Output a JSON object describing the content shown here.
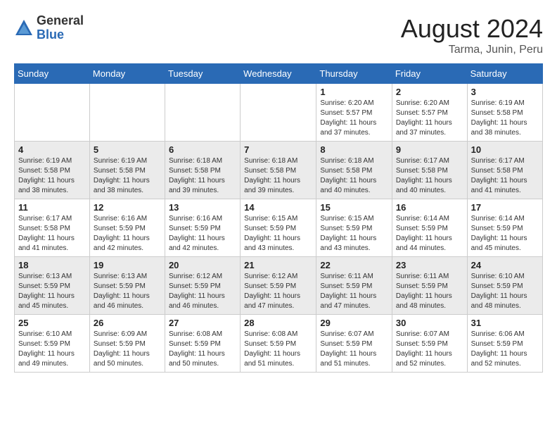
{
  "header": {
    "logo_general": "General",
    "logo_blue": "Blue",
    "month_year": "August 2024",
    "location": "Tarma, Junin, Peru"
  },
  "weekdays": [
    "Sunday",
    "Monday",
    "Tuesday",
    "Wednesday",
    "Thursday",
    "Friday",
    "Saturday"
  ],
  "weeks": [
    {
      "days": [
        {
          "num": "",
          "info": ""
        },
        {
          "num": "",
          "info": ""
        },
        {
          "num": "",
          "info": ""
        },
        {
          "num": "",
          "info": ""
        },
        {
          "num": "1",
          "info": "Sunrise: 6:20 AM\nSunset: 5:57 PM\nDaylight: 11 hours\nand 37 minutes."
        },
        {
          "num": "2",
          "info": "Sunrise: 6:20 AM\nSunset: 5:57 PM\nDaylight: 11 hours\nand 37 minutes."
        },
        {
          "num": "3",
          "info": "Sunrise: 6:19 AM\nSunset: 5:58 PM\nDaylight: 11 hours\nand 38 minutes."
        }
      ]
    },
    {
      "days": [
        {
          "num": "4",
          "info": "Sunrise: 6:19 AM\nSunset: 5:58 PM\nDaylight: 11 hours\nand 38 minutes."
        },
        {
          "num": "5",
          "info": "Sunrise: 6:19 AM\nSunset: 5:58 PM\nDaylight: 11 hours\nand 38 minutes."
        },
        {
          "num": "6",
          "info": "Sunrise: 6:18 AM\nSunset: 5:58 PM\nDaylight: 11 hours\nand 39 minutes."
        },
        {
          "num": "7",
          "info": "Sunrise: 6:18 AM\nSunset: 5:58 PM\nDaylight: 11 hours\nand 39 minutes."
        },
        {
          "num": "8",
          "info": "Sunrise: 6:18 AM\nSunset: 5:58 PM\nDaylight: 11 hours\nand 40 minutes."
        },
        {
          "num": "9",
          "info": "Sunrise: 6:17 AM\nSunset: 5:58 PM\nDaylight: 11 hours\nand 40 minutes."
        },
        {
          "num": "10",
          "info": "Sunrise: 6:17 AM\nSunset: 5:58 PM\nDaylight: 11 hours\nand 41 minutes."
        }
      ]
    },
    {
      "days": [
        {
          "num": "11",
          "info": "Sunrise: 6:17 AM\nSunset: 5:58 PM\nDaylight: 11 hours\nand 41 minutes."
        },
        {
          "num": "12",
          "info": "Sunrise: 6:16 AM\nSunset: 5:59 PM\nDaylight: 11 hours\nand 42 minutes."
        },
        {
          "num": "13",
          "info": "Sunrise: 6:16 AM\nSunset: 5:59 PM\nDaylight: 11 hours\nand 42 minutes."
        },
        {
          "num": "14",
          "info": "Sunrise: 6:15 AM\nSunset: 5:59 PM\nDaylight: 11 hours\nand 43 minutes."
        },
        {
          "num": "15",
          "info": "Sunrise: 6:15 AM\nSunset: 5:59 PM\nDaylight: 11 hours\nand 43 minutes."
        },
        {
          "num": "16",
          "info": "Sunrise: 6:14 AM\nSunset: 5:59 PM\nDaylight: 11 hours\nand 44 minutes."
        },
        {
          "num": "17",
          "info": "Sunrise: 6:14 AM\nSunset: 5:59 PM\nDaylight: 11 hours\nand 45 minutes."
        }
      ]
    },
    {
      "days": [
        {
          "num": "18",
          "info": "Sunrise: 6:13 AM\nSunset: 5:59 PM\nDaylight: 11 hours\nand 45 minutes."
        },
        {
          "num": "19",
          "info": "Sunrise: 6:13 AM\nSunset: 5:59 PM\nDaylight: 11 hours\nand 46 minutes."
        },
        {
          "num": "20",
          "info": "Sunrise: 6:12 AM\nSunset: 5:59 PM\nDaylight: 11 hours\nand 46 minutes."
        },
        {
          "num": "21",
          "info": "Sunrise: 6:12 AM\nSunset: 5:59 PM\nDaylight: 11 hours\nand 47 minutes."
        },
        {
          "num": "22",
          "info": "Sunrise: 6:11 AM\nSunset: 5:59 PM\nDaylight: 11 hours\nand 47 minutes."
        },
        {
          "num": "23",
          "info": "Sunrise: 6:11 AM\nSunset: 5:59 PM\nDaylight: 11 hours\nand 48 minutes."
        },
        {
          "num": "24",
          "info": "Sunrise: 6:10 AM\nSunset: 5:59 PM\nDaylight: 11 hours\nand 48 minutes."
        }
      ]
    },
    {
      "days": [
        {
          "num": "25",
          "info": "Sunrise: 6:10 AM\nSunset: 5:59 PM\nDaylight: 11 hours\nand 49 minutes."
        },
        {
          "num": "26",
          "info": "Sunrise: 6:09 AM\nSunset: 5:59 PM\nDaylight: 11 hours\nand 50 minutes."
        },
        {
          "num": "27",
          "info": "Sunrise: 6:08 AM\nSunset: 5:59 PM\nDaylight: 11 hours\nand 50 minutes."
        },
        {
          "num": "28",
          "info": "Sunrise: 6:08 AM\nSunset: 5:59 PM\nDaylight: 11 hours\nand 51 minutes."
        },
        {
          "num": "29",
          "info": "Sunrise: 6:07 AM\nSunset: 5:59 PM\nDaylight: 11 hours\nand 51 minutes."
        },
        {
          "num": "30",
          "info": "Sunrise: 6:07 AM\nSunset: 5:59 PM\nDaylight: 11 hours\nand 52 minutes."
        },
        {
          "num": "31",
          "info": "Sunrise: 6:06 AM\nSunset: 5:59 PM\nDaylight: 11 hours\nand 52 minutes."
        }
      ]
    }
  ]
}
